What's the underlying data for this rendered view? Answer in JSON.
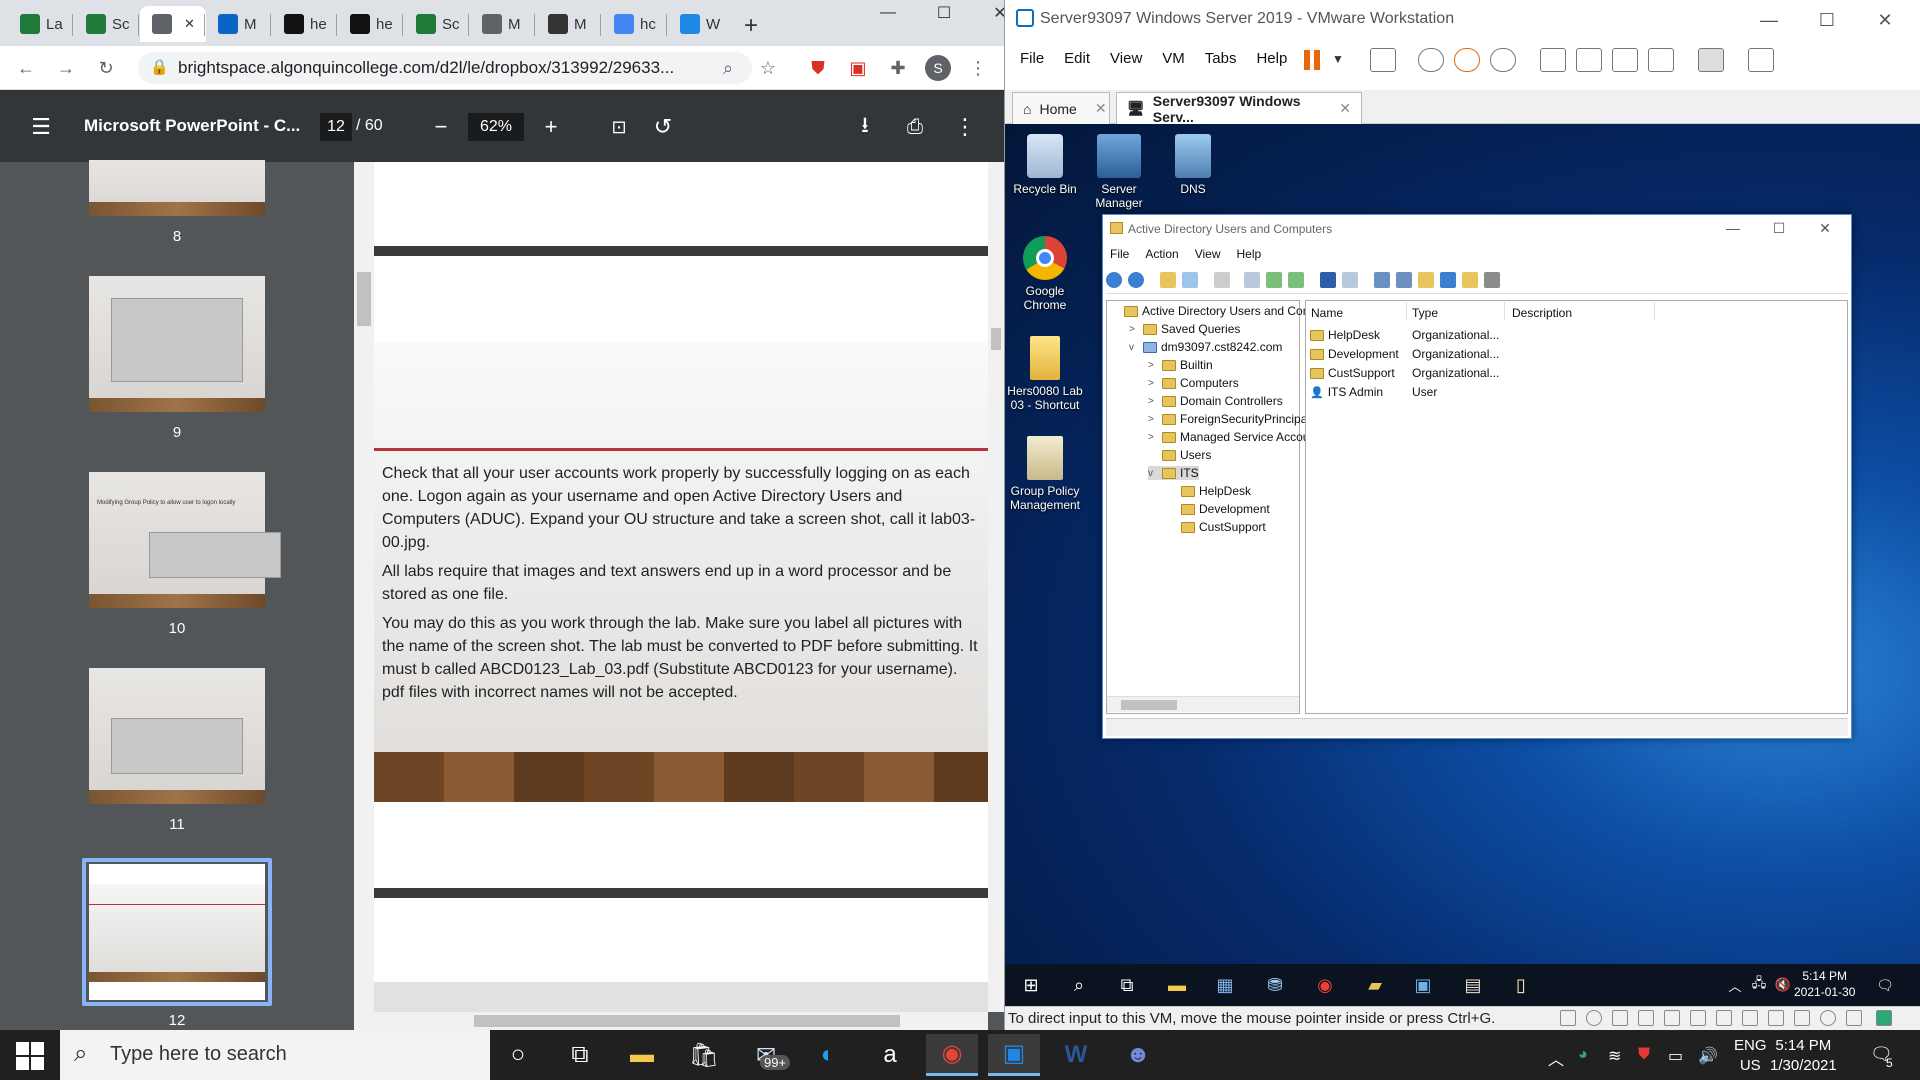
{
  "chrome": {
    "tabs": [
      {
        "label": "La",
        "icon": "acrobat-icon",
        "color": "#1f7a3a"
      },
      {
        "label": "Sc",
        "icon": "acrobat-icon",
        "color": "#1f7a3a"
      },
      {
        "label": "",
        "icon": "globe-icon",
        "color": "#5f6368",
        "active": true
      },
      {
        "label": "M",
        "icon": "outlook-icon",
        "color": "#0a64c8"
      },
      {
        "label": "he",
        "icon": "github-icon",
        "color": "#111111"
      },
      {
        "label": "he",
        "icon": "github-icon",
        "color": "#111111"
      },
      {
        "label": "Sc",
        "icon": "acrobat-icon",
        "color": "#1f7a3a"
      },
      {
        "label": "M",
        "icon": "globe-icon",
        "color": "#5f6368"
      },
      {
        "label": "M",
        "icon": "markdown-icon",
        "color": "#333333"
      },
      {
        "label": "hc",
        "icon": "google-icon",
        "color": "#4285f4"
      },
      {
        "label": "W",
        "icon": "vscode-icon",
        "color": "#1e88e5"
      }
    ],
    "url": "brightspace.algonquincollege.com/d2l/le/dropbox/313992/29633...",
    "profile_initial": "S"
  },
  "pdf": {
    "title": "Microsoft PowerPoint - C...",
    "page": "12",
    "total": "/ 60",
    "zoom": "62%",
    "thumb_numbers": [
      "8",
      "9",
      "10",
      "11",
      "12"
    ],
    "thumb10_title": "Modifying Group Policy to allow user to logon locally",
    "slide_paragraphs": [
      "Check that all your user accounts work properly by successfully logging on as each one. Logon again as your username and open Active Directory Users and Computers (ADUC). Expand your OU structure and take a screen shot, call it lab03-00.jpg.",
      "All labs require that images and text answers end up in a word processor and be stored as one file.",
      "You may do this as you work through the lab. Make sure you label all pictures with the name of the screen shot. The lab must be converted to PDF before submitting. It must b called ABCD0123_Lab_03.pdf (Substitute ABCD0123 for your username). pdf files with incorrect names will not be accepted."
    ]
  },
  "vmware": {
    "title": "Server93097 Windows Server 2019 - VMware Workstation",
    "menu": [
      "File",
      "Edit",
      "View",
      "VM",
      "Tabs",
      "Help"
    ],
    "tabs": [
      {
        "label": "Home"
      },
      {
        "label": "Server93097 Windows Serv..."
      }
    ],
    "desktop_icons": [
      {
        "label": "Recycle Bin"
      },
      {
        "label": "Server Manager"
      },
      {
        "label": "DNS"
      },
      {
        "label": "Google Chrome"
      },
      {
        "label": "Hers0080 Lab 03 - Shortcut"
      },
      {
        "label": "Group Policy Management"
      }
    ],
    "status_text": "To direct input to this VM, move the mouse pointer inside or press Ctrl+G.",
    "vm_clock": {
      "time": "5:14 PM",
      "date": "2021-01-30"
    }
  },
  "aduc": {
    "title": "Active Directory Users and Computers",
    "menu": [
      "File",
      "Action",
      "View",
      "Help"
    ],
    "tree": [
      {
        "label": "Active Directory Users and Com",
        "level": 0,
        "exp": ""
      },
      {
        "label": "Saved Queries",
        "level": 1,
        "exp": ">"
      },
      {
        "label": "dm93097.cst8242.com",
        "level": 1,
        "exp": "v"
      },
      {
        "label": "Builtin",
        "level": 2,
        "exp": ">"
      },
      {
        "label": "Computers",
        "level": 2,
        "exp": ">"
      },
      {
        "label": "Domain Controllers",
        "level": 2,
        "exp": ">"
      },
      {
        "label": "ForeignSecurityPrincipal:",
        "level": 2,
        "exp": ">"
      },
      {
        "label": "Managed Service Accour",
        "level": 2,
        "exp": ">"
      },
      {
        "label": "Users",
        "level": 2,
        "exp": ""
      },
      {
        "label": "ITS",
        "level": 2,
        "exp": "v"
      },
      {
        "label": "HelpDesk",
        "level": 3,
        "exp": ""
      },
      {
        "label": "Development",
        "level": 3,
        "exp": ""
      },
      {
        "label": "CustSupport",
        "level": 3,
        "exp": ""
      }
    ],
    "columns": [
      "Name",
      "Type",
      "Description"
    ],
    "rows": [
      {
        "name": "HelpDesk",
        "type": "Organizational...",
        "icon": "ou-folder-icon"
      },
      {
        "name": "Development",
        "type": "Organizational...",
        "icon": "ou-folder-icon"
      },
      {
        "name": "CustSupport",
        "type": "Organizational...",
        "icon": "ou-folder-icon"
      },
      {
        "name": "ITS Admin",
        "type": "User",
        "icon": "user-icon"
      }
    ]
  },
  "host_taskbar": {
    "search_placeholder": "Type here to search",
    "mail_badge": "99+",
    "lang": "ENG",
    "region": "US",
    "time": "5:14 PM",
    "date": "1/30/2021",
    "notifications": "5"
  }
}
